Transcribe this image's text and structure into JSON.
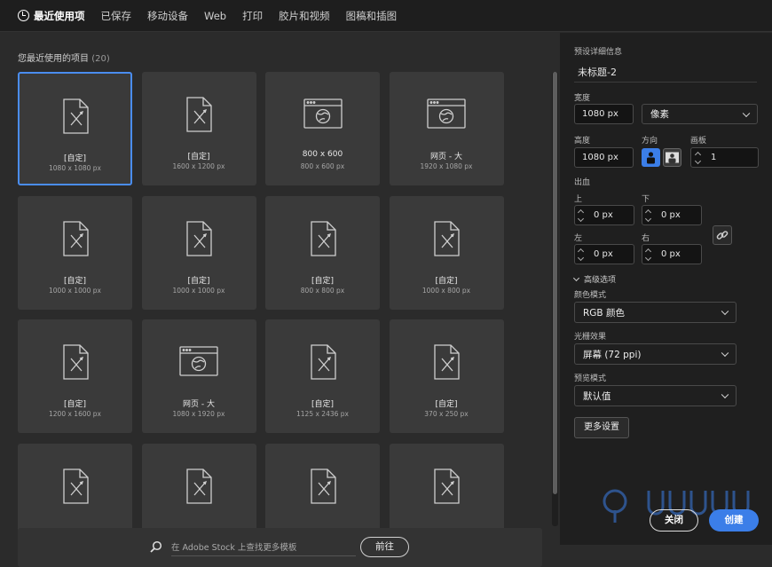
{
  "tabs": [
    {
      "label": "最近使用项"
    },
    {
      "label": "已保存"
    },
    {
      "label": "移动设备"
    },
    {
      "label": "Web"
    },
    {
      "label": "打印"
    },
    {
      "label": "胶片和视频"
    },
    {
      "label": "图稿和插图"
    }
  ],
  "recent": {
    "title": "您最近使用的项目",
    "count": "(20)",
    "cards": [
      {
        "name": "[自定]",
        "size": "1080 x 1080 px",
        "icon": "custom-doc-icon",
        "selected": true
      },
      {
        "name": "[自定]",
        "size": "1600 x 1200 px",
        "icon": "custom-doc-icon"
      },
      {
        "name": "800 x 600",
        "size": "800 x 600 px",
        "icon": "web-icon"
      },
      {
        "name": "网页 - 大",
        "size": "1920 x 1080 px",
        "icon": "web-icon"
      },
      {
        "name": "[自定]",
        "size": "1000 x 1000 px",
        "icon": "custom-doc-icon"
      },
      {
        "name": "[自定]",
        "size": "1000 x 1000 px",
        "icon": "custom-doc-icon"
      },
      {
        "name": "[自定]",
        "size": "800 x 800 px",
        "icon": "custom-doc-icon"
      },
      {
        "name": "[自定]",
        "size": "1000 x 800 px",
        "icon": "custom-doc-icon"
      },
      {
        "name": "[自定]",
        "size": "1200 x 1600 px",
        "icon": "custom-doc-icon"
      },
      {
        "name": "网页 - 大",
        "size": "1080 x 1920 px",
        "icon": "web-icon"
      },
      {
        "name": "[自定]",
        "size": "1125 x 2436 px",
        "icon": "custom-doc-icon"
      },
      {
        "name": "[自定]",
        "size": "370 x 250 px",
        "icon": "custom-doc-icon"
      },
      {
        "name": "",
        "size": "",
        "icon": "custom-doc-icon"
      },
      {
        "name": "",
        "size": "",
        "icon": "custom-doc-icon"
      },
      {
        "name": "",
        "size": "",
        "icon": "custom-doc-icon"
      },
      {
        "name": "",
        "size": "",
        "icon": "custom-doc-icon"
      }
    ]
  },
  "search": {
    "placeholder": "在 Adobe Stock 上查找更多模板",
    "go_label": "前往"
  },
  "preset": {
    "section_label": "预设详细信息",
    "doc_name": "未标题-2",
    "width_label": "宽度",
    "width_value": "1080 px",
    "unit": "像素",
    "height_label": "高度",
    "height_value": "1080 px",
    "orientation_label": "方向",
    "artboards_label": "画板",
    "artboards_value": "1",
    "bleed_label": "出血",
    "top_label": "上",
    "top_value": "0 px",
    "bottom_label": "下",
    "bottom_value": "0 px",
    "left_label": "左",
    "left_value": "0 px",
    "right_label": "右",
    "right_value": "0 px",
    "advanced_label": "高级选项",
    "color_mode_label": "颜色模式",
    "color_mode_value": "RGB 颜色",
    "raster_label": "光栅效果",
    "raster_value": "屏幕 (72 ppi)",
    "preview_label": "预览模式",
    "preview_value": "默认值",
    "more_settings": "更多设置",
    "close": "关闭",
    "create": "创建"
  },
  "colors": {
    "accent": "#3b7ee8",
    "panel": "#1f1f1f",
    "card": "#3a3a3a"
  }
}
